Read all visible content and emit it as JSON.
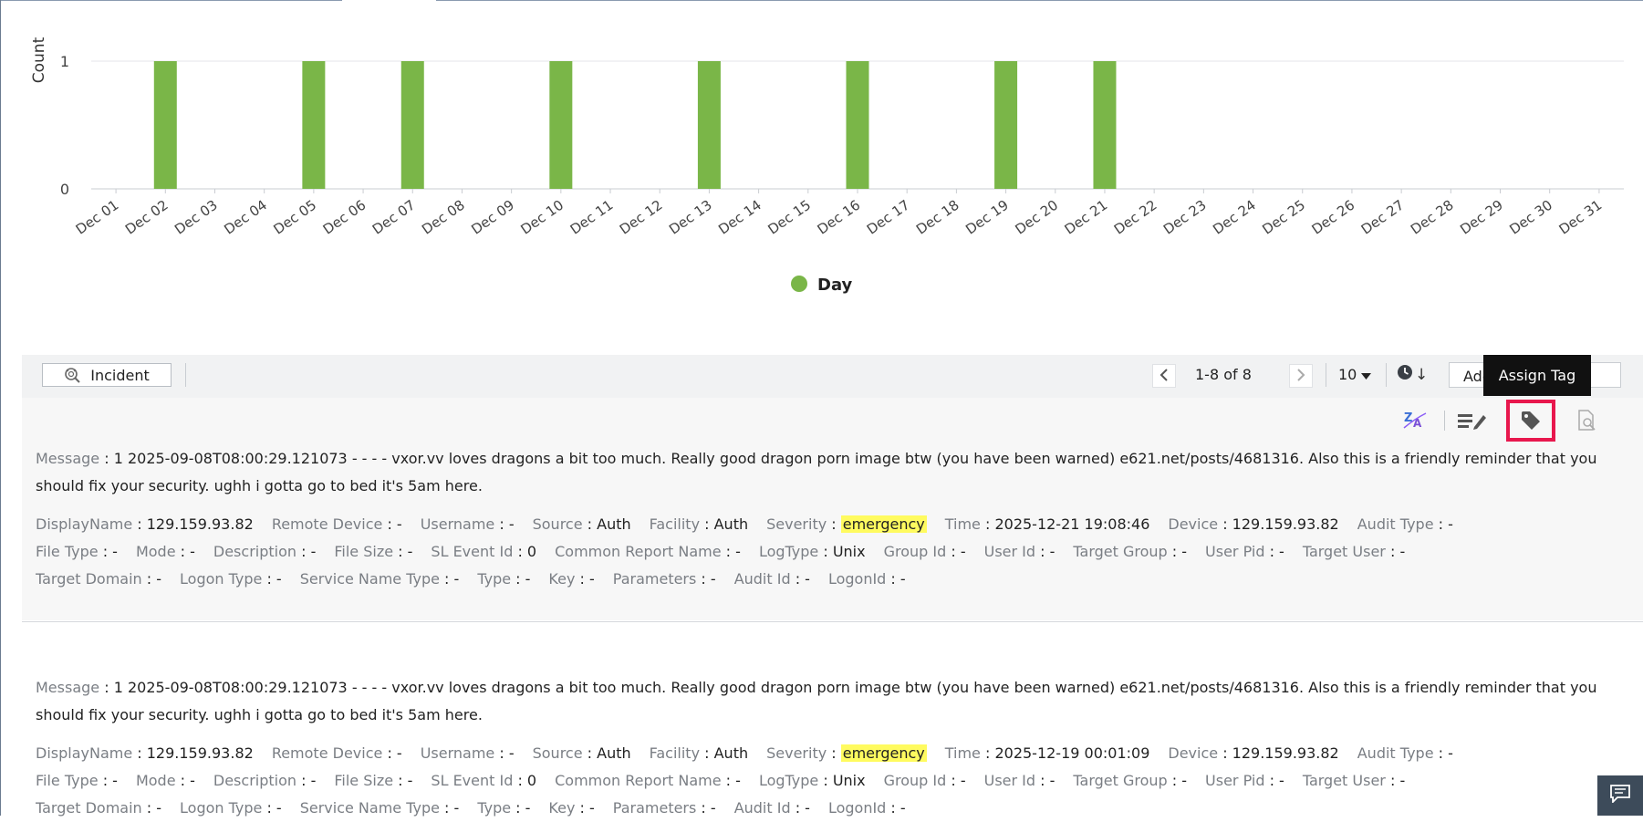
{
  "chart": {
    "y_axis_label": "Count",
    "legend_label": "Day",
    "bar_color": "#7ab648"
  },
  "chart_data": {
    "type": "bar",
    "categories": [
      "Dec 01",
      "Dec 02",
      "Dec 03",
      "Dec 04",
      "Dec 05",
      "Dec 06",
      "Dec 07",
      "Dec 08",
      "Dec 09",
      "Dec 10",
      "Dec 11",
      "Dec 12",
      "Dec 13",
      "Dec 14",
      "Dec 15",
      "Dec 16",
      "Dec 17",
      "Dec 18",
      "Dec 19",
      "Dec 20",
      "Dec 21",
      "Dec 22",
      "Dec 23",
      "Dec 24",
      "Dec 25",
      "Dec 26",
      "Dec 27",
      "Dec 28",
      "Dec 29",
      "Dec 30",
      "Dec 31"
    ],
    "series": [
      {
        "name": "Day",
        "values": [
          0,
          1,
          0,
          0,
          1,
          0,
          1,
          0,
          0,
          1,
          0,
          0,
          1,
          0,
          0,
          1,
          0,
          0,
          1,
          0,
          1,
          0,
          0,
          0,
          0,
          0,
          0,
          0,
          0,
          0,
          0
        ]
      }
    ],
    "ylabel": "Count",
    "xlabel": "",
    "yticks": [
      0,
      1
    ],
    "ylim": [
      0,
      1
    ],
    "grid": true,
    "legend_position": "bottom-center"
  },
  "toolbar": {
    "incident_label": "Incident",
    "pager_label": "1-8 of 8",
    "per_page": "10",
    "add_fields_label": "Add Fields",
    "sort_arrow": "↓"
  },
  "tooltip": {
    "text": "Assign Tag"
  },
  "icons": {
    "translate": "translate-icon",
    "edit": "edit-icon",
    "tag": "tag-icon",
    "inspect": "document-search-icon",
    "chat": "chat-icon"
  },
  "records": [
    {
      "message_key": "Message",
      "message": "1 2025-09-08T08:00:29.121073 - - - - vxor.vv loves dragons a bit too much. Really good dragon porn image btw (you have been warned) e621.net/posts/4681316. Also this is a friendly reminder that you should fix your security. ughh i gotta go to bed it's 5am here.",
      "rows": [
        [
          {
            "k": "DisplayName",
            "v": "129.159.93.82"
          },
          {
            "k": "Remote Device",
            "v": "-"
          },
          {
            "k": "Username",
            "v": "-"
          },
          {
            "k": "Source",
            "v": "Auth"
          },
          {
            "k": "Facility",
            "v": "Auth"
          },
          {
            "k": "Severity",
            "v": "emergency"
          },
          {
            "k": "Time",
            "v": "2025-12-21 19:08:46"
          },
          {
            "k": "Device",
            "v": "129.159.93.82"
          },
          {
            "k": "Audit Type",
            "v": "-"
          }
        ],
        [
          {
            "k": "File Type",
            "v": "-"
          },
          {
            "k": "Mode",
            "v": "-"
          },
          {
            "k": "Description",
            "v": "-"
          },
          {
            "k": "File Size",
            "v": "-"
          },
          {
            "k": "SL Event Id",
            "v": "0"
          },
          {
            "k": "Common Report Name",
            "v": "-"
          },
          {
            "k": "LogType",
            "v": "Unix"
          },
          {
            "k": "Group Id",
            "v": "-"
          },
          {
            "k": "User Id",
            "v": "-"
          },
          {
            "k": "Target Group",
            "v": "-"
          },
          {
            "k": "User Pid",
            "v": "-"
          },
          {
            "k": "Target User",
            "v": "-"
          }
        ],
        [
          {
            "k": "Target Domain",
            "v": "-"
          },
          {
            "k": "Logon Type",
            "v": "-"
          },
          {
            "k": "Service Name Type",
            "v": "-"
          },
          {
            "k": "Type",
            "v": "-"
          },
          {
            "k": "Key",
            "v": "-"
          },
          {
            "k": "Parameters",
            "v": "-"
          },
          {
            "k": "Audit Id",
            "v": "-"
          },
          {
            "k": "LogonId",
            "v": "-"
          }
        ]
      ]
    },
    {
      "message_key": "Message",
      "message": "1 2025-09-08T08:00:29.121073 - - - - vxor.vv loves dragons a bit too much. Really good dragon porn image btw (you have been warned) e621.net/posts/4681316. Also this is a friendly reminder that you should fix your security. ughh i gotta go to bed it's 5am here.",
      "rows": [
        [
          {
            "k": "DisplayName",
            "v": "129.159.93.82"
          },
          {
            "k": "Remote Device",
            "v": "-"
          },
          {
            "k": "Username",
            "v": "-"
          },
          {
            "k": "Source",
            "v": "Auth"
          },
          {
            "k": "Facility",
            "v": "Auth"
          },
          {
            "k": "Severity",
            "v": "emergency"
          },
          {
            "k": "Time",
            "v": "2025-12-19 00:01:09"
          },
          {
            "k": "Device",
            "v": "129.159.93.82"
          },
          {
            "k": "Audit Type",
            "v": "-"
          }
        ],
        [
          {
            "k": "File Type",
            "v": "-"
          },
          {
            "k": "Mode",
            "v": "-"
          },
          {
            "k": "Description",
            "v": "-"
          },
          {
            "k": "File Size",
            "v": "-"
          },
          {
            "k": "SL Event Id",
            "v": "0"
          },
          {
            "k": "Common Report Name",
            "v": "-"
          },
          {
            "k": "LogType",
            "v": "Unix"
          },
          {
            "k": "Group Id",
            "v": "-"
          },
          {
            "k": "User Id",
            "v": "-"
          },
          {
            "k": "Target Group",
            "v": "-"
          },
          {
            "k": "User Pid",
            "v": "-"
          },
          {
            "k": "Target User",
            "v": "-"
          }
        ],
        [
          {
            "k": "Target Domain",
            "v": "-"
          },
          {
            "k": "Logon Type",
            "v": "-"
          },
          {
            "k": "Service Name Type",
            "v": "-"
          },
          {
            "k": "Type",
            "v": "-"
          },
          {
            "k": "Key",
            "v": "-"
          },
          {
            "k": "Parameters",
            "v": "-"
          },
          {
            "k": "Audit Id",
            "v": "-"
          },
          {
            "k": "LogonId",
            "v": "-"
          }
        ]
      ]
    }
  ]
}
